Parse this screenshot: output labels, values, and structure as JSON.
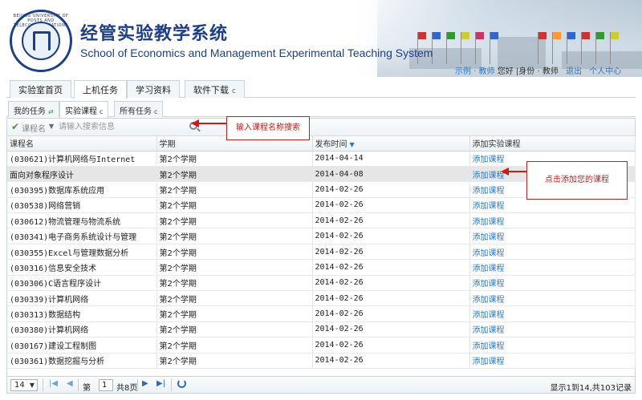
{
  "header": {
    "logo_ring_text": "BEIJING UNIVERSITY OF POSTS AND TELECOMMUNICATIONS",
    "title_cn": "经管实验教学系统",
    "title_en": "School of Economics and Management Experimental Teaching System",
    "user": {
      "user_link": "示例 · 教师",
      "greeting": "您好",
      "role_text": "|身份 · 教师",
      "logout": "退出",
      "personal": "个人中心"
    }
  },
  "main_tabs": [
    {
      "label": "实验室首页"
    },
    {
      "label": "上机任务"
    },
    {
      "label": "学习资料"
    },
    {
      "label": "软件下载"
    }
  ],
  "sub_tabs": [
    {
      "label": "我的任务"
    },
    {
      "label": "实验课程"
    },
    {
      "label": "所有任务"
    }
  ],
  "search": {
    "field": "课程名",
    "placeholder": "请输入搜索信息"
  },
  "table": {
    "columns": [
      "课程名",
      "学期",
      "发布时间",
      "添加实验课程"
    ],
    "rows": [
      {
        "name": "(030621)计算机网络与Internet",
        "term": "第2个学期",
        "date": "2014-04-14",
        "action": "添加课程"
      },
      {
        "name": "面向对象程序设计",
        "term": "第2个学期",
        "date": "2014-04-08",
        "action": "添加课程"
      },
      {
        "name": "(030395)数据库系统应用",
        "term": "第2个学期",
        "date": "2014-02-26",
        "action": "添加课程"
      },
      {
        "name": "(030538)网络营销",
        "term": "第2个学期",
        "date": "2014-02-26",
        "action": "添加课程"
      },
      {
        "name": "(030612)物流管理与物流系统",
        "term": "第2个学期",
        "date": "2014-02-26",
        "action": "添加课程"
      },
      {
        "name": "(030341)电子商务系统设计与管理",
        "term": "第2个学期",
        "date": "2014-02-26",
        "action": "添加课程"
      },
      {
        "name": "(030355)Excel与管理数据分析",
        "term": "第2个学期",
        "date": "2014-02-26",
        "action": "添加课程"
      },
      {
        "name": "(030316)信息安全技术",
        "term": "第2个学期",
        "date": "2014-02-26",
        "action": "添加课程"
      },
      {
        "name": "(030306)C语言程序设计",
        "term": "第2个学期",
        "date": "2014-02-26",
        "action": "添加课程"
      },
      {
        "name": "(030339)计算机网络",
        "term": "第2个学期",
        "date": "2014-02-26",
        "action": "添加课程"
      },
      {
        "name": "(030313)数据结构",
        "term": "第2个学期",
        "date": "2014-02-26",
        "action": "添加课程"
      },
      {
        "name": "(030380)计算机网络",
        "term": "第2个学期",
        "date": "2014-02-26",
        "action": "添加课程"
      },
      {
        "name": "(030167)建设工程制图",
        "term": "第2个学期",
        "date": "2014-02-26",
        "action": "添加课程"
      },
      {
        "name": "(030361)数据挖掘与分析",
        "term": "第2个学期",
        "date": "2014-02-26",
        "action": "添加课程"
      }
    ]
  },
  "pager": {
    "page_size": "14",
    "page_prefix": "第",
    "current_page": "1",
    "page_total_text": "共8页",
    "summary": "显示1到14,共103记录"
  },
  "annotations": {
    "search_tip": "输入课程名称搜索",
    "add_tip": "点击添加您的课程"
  },
  "colors": {
    "brand": "#1e3f86",
    "link": "#2a78c6",
    "annotation": "#c02020"
  }
}
